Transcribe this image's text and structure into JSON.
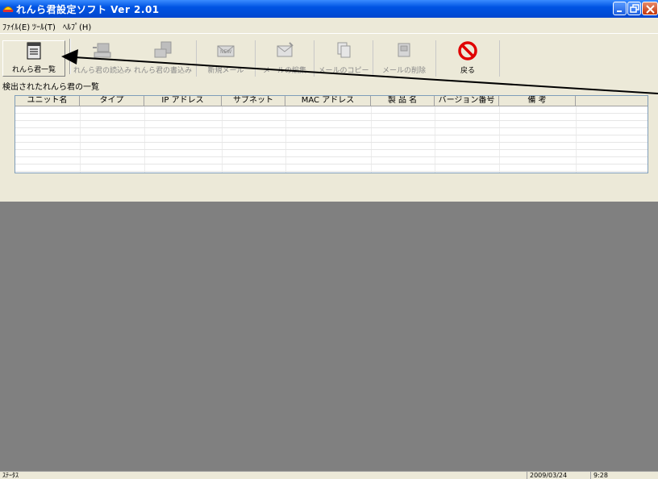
{
  "window": {
    "title": "れんら君設定ソフト  Ver 2.01",
    "buttons": {
      "minimize": "minimize",
      "maximize": "maximize",
      "close": "close"
    }
  },
  "menubar": {
    "file": "ﾌｧｲﾙ(E)",
    "tool": "ﾂｰﾙ(T)",
    "help": "ﾍﾙﾌﾟ(H)"
  },
  "toolbar": {
    "list": "れんら君一覧",
    "read": "れんら君の読込み",
    "write": "れんら君の書込み",
    "new_mail": "新規メール",
    "edit_mail": "メールの編集",
    "copy_mail": "メールのコピー",
    "delete_mail": "メールの削除",
    "back": "戻る"
  },
  "list": {
    "caption": "検出されたれんら君の一覧",
    "columns": [
      "ユニット名",
      "タイプ",
      "IP アドレス",
      "サブネット",
      "MAC アドレス",
      "製 品 名",
      "バージョン番号",
      "備  考"
    ]
  },
  "statusbar": {
    "left": "ｽﾃｰﾀｽ",
    "date": "2009/03/24",
    "time": "9:28"
  },
  "colors": {
    "titlebar": "#0054e3",
    "lower_panel": "#808080",
    "face": "#ece9d8"
  }
}
